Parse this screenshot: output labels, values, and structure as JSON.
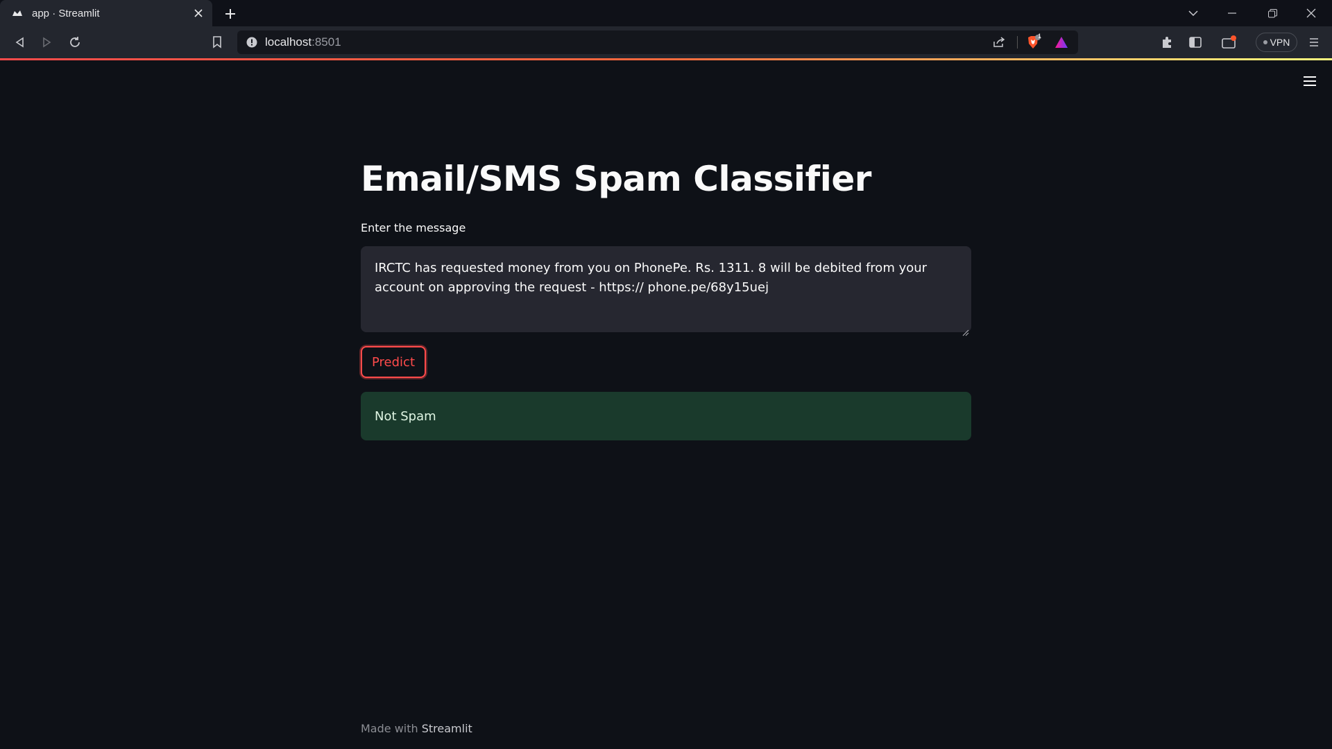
{
  "browser": {
    "tab_title": "app · Streamlit",
    "url_host": "localhost",
    "url_port": ":8501",
    "vpn_label": "VPN",
    "brave_badge": "1",
    "icons": [
      "streamlit-favicon",
      "close-icon",
      "plus-icon",
      "chevron-down-icon",
      "minimize-icon",
      "restore-icon",
      "close-window-icon",
      "back-icon",
      "forward-icon",
      "reload-icon",
      "bookmark-icon",
      "info-icon",
      "share-icon",
      "brave-shield-icon",
      "brave-rewards-icon",
      "extensions-icon",
      "sidebar-icon",
      "wallet-icon",
      "menu-icon"
    ],
    "accent_colors": {
      "loadbar_start": "#ff4b4b",
      "loadbar_end": "#fffd80"
    }
  },
  "app": {
    "title": "Email/SMS Spam Classifier",
    "input_label": "Enter the message",
    "input_value": "IRCTC has requested money from you on PhonePe. Rs. 1311. 8 will be debited from your account on approving the request - https:// phone.pe/68y15uej",
    "predict_label": "Predict",
    "result_text": "Not Spam",
    "footer_prefix": "Made with ",
    "footer_brand": "Streamlit",
    "colors": {
      "primary": "#ff4b4b",
      "background": "#0e1117",
      "input_bg": "#262730",
      "success_bg": "#1a3a2c"
    }
  }
}
